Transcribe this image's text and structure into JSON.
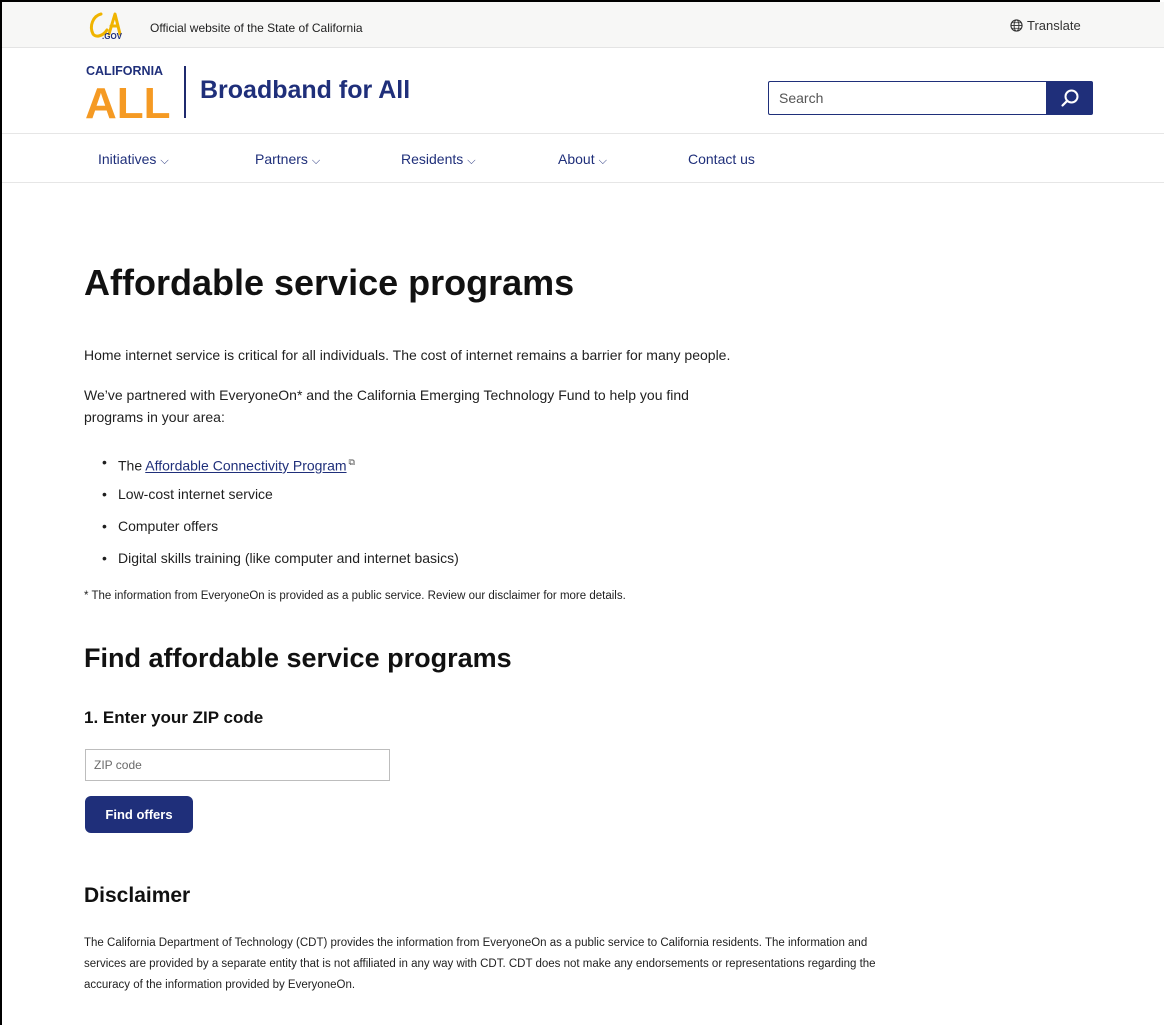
{
  "utility": {
    "official_text": "Official website of the State of California",
    "translate_label": "Translate",
    "logo_text": "CA.GOV"
  },
  "header": {
    "brand_top": "CALIFORNIA",
    "brand_bottom": "ALL",
    "site_title": "Broadband for All",
    "search_placeholder": "Search"
  },
  "nav": {
    "items": [
      {
        "label": "Initiatives",
        "dropdown": true
      },
      {
        "label": "Partners",
        "dropdown": true
      },
      {
        "label": "Residents",
        "dropdown": true
      },
      {
        "label": "About",
        "dropdown": true
      },
      {
        "label": "Contact us",
        "dropdown": false
      }
    ]
  },
  "main": {
    "title": "Affordable service programs",
    "intro": "Home internet service is critical for all individuals. The cost of internet remains a barrier for many people.",
    "partner_line1": "We’ve partnered with EveryoneOn* and the California Emerging Technology Fund to help you find",
    "partner_line2": "programs in your area:",
    "list": {
      "item1_prefix": "The",
      "item1_link": "Affordable Connectivity Program",
      "item2": "Low-cost internet service",
      "item3": "Computer offers",
      "item4": "Digital skills training (like computer and internet basics)"
    },
    "footnote": "* The information from EveryoneOn is provided as a public service. Review our disclaimer for more details.",
    "find_heading": "Find affordable service programs",
    "step1": "1. Enter your ZIP code",
    "zip_placeholder": "ZIP code",
    "find_button": "Find offers",
    "disclaimer_heading": "Disclaimer",
    "disclaimer_line1": "The California Department of Technology (CDT) provides the information from EveryoneOn as a public service to California residents. The information and",
    "disclaimer_line2": "services are provided by a separate entity that is not affiliated in any way with CDT. CDT does not make any endorsements or representations regarding the",
    "disclaimer_line3": "accuracy of the information provided by EveryoneOn."
  },
  "colors": {
    "brand_navy": "#1f2f7a",
    "brand_orange": "#f59a23"
  },
  "icons": [
    "ca-gov-logo",
    "globe-icon",
    "search-icon",
    "chevron-down-icon",
    "external-link-icon"
  ]
}
